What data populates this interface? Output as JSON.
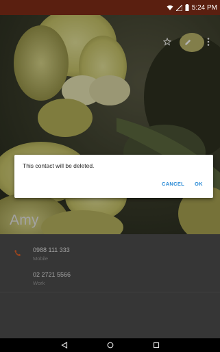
{
  "status_bar": {
    "time": "5:24 PM",
    "icons": [
      "wifi-icon",
      "signal-icon",
      "battery-icon"
    ],
    "background": "#5a1f10"
  },
  "header": {
    "actions": [
      "star-icon",
      "edit-pencil-icon",
      "more-vert-icon"
    ]
  },
  "contact": {
    "name": "Amy",
    "phones": [
      {
        "number": "0988 111 333",
        "type": "Mobile",
        "icon": "phone-icon"
      },
      {
        "number": "02 2721 5566",
        "type": "Work",
        "icon": ""
      }
    ]
  },
  "dialog": {
    "message": "This contact will be deleted.",
    "cancel_label": "CANCEL",
    "ok_label": "OK",
    "button_color": "#2b8bd6"
  },
  "nav_bar": {
    "buttons": [
      "back-icon",
      "home-icon",
      "recents-icon"
    ]
  },
  "colors": {
    "accent_phone_icon": "#e0632a",
    "details_background": "#4e4e4e"
  }
}
